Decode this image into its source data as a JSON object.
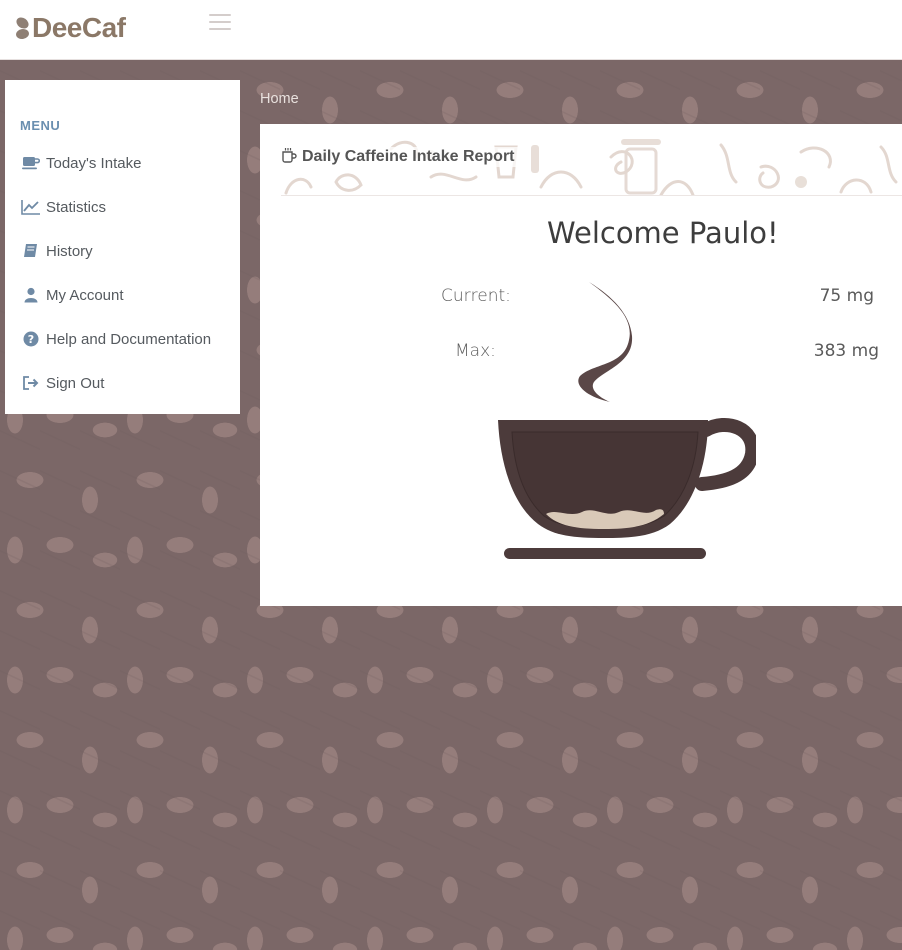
{
  "header": {
    "logo_text": "DeeCaf",
    "menu_toggle_icon": "hamburger-icon"
  },
  "sidebar": {
    "title": "MENU",
    "items": [
      {
        "label": "Today's Intake",
        "icon": "coffee-cup-icon"
      },
      {
        "label": "Statistics",
        "icon": "line-chart-icon"
      },
      {
        "label": "History",
        "icon": "book-icon"
      },
      {
        "label": "My Account",
        "icon": "user-icon"
      },
      {
        "label": "Help and Documentation",
        "icon": "question-circle-icon"
      },
      {
        "label": "Sign Out",
        "icon": "sign-out-icon"
      }
    ]
  },
  "breadcrumb": {
    "home": "Home"
  },
  "report": {
    "title": "Daily Caffeine Intake Report",
    "title_icon": "mug-icon",
    "welcome": "Welcome Paulo!",
    "current_label": "Current:",
    "current_value": "75 mg",
    "max_label": "Max:",
    "max_value": "383 mg"
  },
  "colors": {
    "accent_menu": "#6a8fb0",
    "logo": "#8b7867",
    "background": "#7b6767",
    "cup": "#4a3838",
    "cup_foam": "#d9c9b8"
  }
}
